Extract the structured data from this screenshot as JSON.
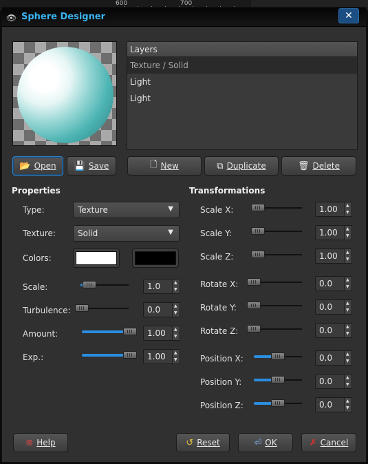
{
  "background_app": {
    "ruler_labels": [
      "600",
      "700"
    ]
  },
  "dialog": {
    "title": "Sphere Designer",
    "close_glyph": "✕"
  },
  "layers": {
    "header": "Layers",
    "items": [
      "Texture / Solid",
      "Light",
      "Light"
    ],
    "selected_index": 0
  },
  "buttons": {
    "open": "Open",
    "save": "Save",
    "new": "New",
    "duplicate": "Duplicate",
    "delete": "Delete",
    "help": "Help",
    "reset": "Reset",
    "ok": "OK",
    "cancel": "Cancel"
  },
  "properties": {
    "title": "Properties",
    "type_label": "Type:",
    "type_value": "Texture",
    "texture_label": "Texture:",
    "texture_value": "Solid",
    "colors_label": "Colors:",
    "color1": "#ffffff",
    "color2": "#000000",
    "scale_label": "Scale:",
    "scale_value": "1.0",
    "scale_level": 0.05,
    "turbulence_label": "Turbulence:",
    "turbulence_value": "0.0",
    "turbulence_level": 0.0,
    "amount_label": "Amount:",
    "amount_value": "1.00",
    "amount_level": 1.0,
    "exp_label": "Exp.:",
    "exp_value": "1.00",
    "exp_level": 1.0
  },
  "transformations": {
    "title": "Transformations",
    "scale_x_label": "Scale X:",
    "scale_x_value": "1.00",
    "scale_y_label": "Scale Y:",
    "scale_y_value": "1.00",
    "scale_z_label": "Scale Z:",
    "scale_z_value": "1.00",
    "rotate_x_label": "Rotate X:",
    "rotate_x_value": "0.0",
    "rotate_y_label": "Rotate Y:",
    "rotate_y_value": "0.0",
    "rotate_z_label": "Rotate Z:",
    "rotate_z_value": "0.0",
    "position_x_label": "Position X:",
    "position_x_value": "0.0",
    "position_y_label": "Position Y:",
    "position_y_value": "0.0",
    "position_z_label": "Position Z:",
    "position_z_value": "0.0"
  },
  "colors": {
    "accent": "#3ab4f2",
    "slider_fill": "#2a8de0",
    "dialog_bg": "#303030"
  },
  "icons": {
    "open": "folder-icon",
    "save": "floppy-icon",
    "new": "document-icon",
    "duplicate": "duplicate-icon",
    "delete": "trash-icon",
    "help": "lifebuoy-icon",
    "reset": "reset-icon",
    "ok": "enter-icon",
    "cancel": "cancel-x-icon"
  }
}
